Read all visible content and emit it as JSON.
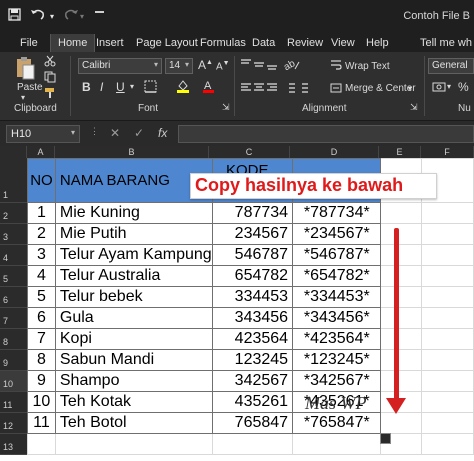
{
  "titlebar": {
    "doc_title": "Contoh File B",
    "icons": [
      "save-icon",
      "undo-icon",
      "redo-icon"
    ]
  },
  "menu": [
    "File",
    "Home",
    "Insert",
    "Page Layout",
    "Formulas",
    "Data",
    "Review",
    "View",
    "Help"
  ],
  "tell_me": "Tell me wh",
  "ribbon": {
    "paste_label": "Paste",
    "font_name": "Calibri",
    "font_size": "14",
    "wrap_text": "Wrap Text",
    "merge_center": "Merge & Center",
    "number_format": "General",
    "groups": {
      "clipboard": "Clipboard",
      "font": "Font",
      "alignment": "Alignment",
      "number": "Nu"
    },
    "bold": "B",
    "italic": "I",
    "underline": "U"
  },
  "formula_bar": {
    "name_box": "H10",
    "fx": "fx"
  },
  "columns": [
    "A",
    "B",
    "C",
    "D",
    "E",
    "F"
  ],
  "rows": [
    "1",
    "2",
    "3",
    "4",
    "5",
    "6",
    "7",
    "8",
    "9",
    "10",
    "11",
    "12",
    "13"
  ],
  "table": {
    "headers": {
      "no": "NO",
      "nama": "NAMA BARANG",
      "kode": "KODE"
    },
    "items": [
      {
        "no": "1",
        "nama": "Mie Kuning",
        "kode": "787734",
        "barcode": "*787734*"
      },
      {
        "no": "2",
        "nama": "Mie Putih",
        "kode": "234567",
        "barcode": "*234567*"
      },
      {
        "no": "3",
        "nama": "Telur Ayam Kampung",
        "kode": "546787",
        "barcode": "*546787*"
      },
      {
        "no": "4",
        "nama": "Telur Australia",
        "kode": "654782",
        "barcode": "*654782*"
      },
      {
        "no": "5",
        "nama": "Telur bebek",
        "kode": "334453",
        "barcode": "*334453*"
      },
      {
        "no": "6",
        "nama": "Gula",
        "kode": "343456",
        "barcode": "*343456*"
      },
      {
        "no": "7",
        "nama": "Kopi",
        "kode": "423564",
        "barcode": "*423564*"
      },
      {
        "no": "8",
        "nama": "Sabun Mandi",
        "kode": "123245",
        "barcode": "*123245*"
      },
      {
        "no": "9",
        "nama": "Shampo",
        "kode": "342567",
        "barcode": "*342567*"
      },
      {
        "no": "10",
        "nama": "Teh Kotak",
        "kode": "435261",
        "barcode": "*435261*"
      },
      {
        "no": "11",
        "nama": "Teh Botol",
        "kode": "765847",
        "barcode": "*765847*"
      }
    ]
  },
  "callout": "Copy hasilnya ke bawah",
  "watermark": "Mas WP",
  "colors": {
    "header_fill": "#4e86cf",
    "callout_text": "#e01a1a",
    "arrow": "#d42020",
    "dark_chrome": "#1f1f1f"
  }
}
